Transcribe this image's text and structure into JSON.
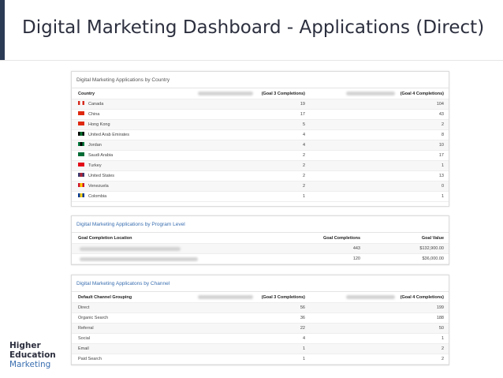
{
  "slide": {
    "title": "Digital Marketing Dashboard - Applications (Direct)",
    "logo": {
      "line1": "Higher",
      "line2": "Education",
      "line3": "Marketing"
    }
  },
  "country_panel": {
    "title": "Digital Marketing Applications by Country",
    "headers": {
      "name": "Country",
      "v1": "(Goal 3 Completions)",
      "v2": "(Goal 4 Completions)"
    },
    "rows": [
      {
        "name": "Canada",
        "v1": "19",
        "v2": "104",
        "flag": [
          "#ffffff",
          "#d52b1e"
        ]
      },
      {
        "name": "China",
        "v1": "17",
        "v2": "43",
        "flag": [
          "#de2910",
          "#de2910"
        ]
      },
      {
        "name": "Hong Kong",
        "v1": "5",
        "v2": "2",
        "flag": [
          "#de2910",
          "#de2910"
        ]
      },
      {
        "name": "United Arab Emirates",
        "v1": "4",
        "v2": "8",
        "flag": [
          "#00732f",
          "#000000"
        ]
      },
      {
        "name": "Jordan",
        "v1": "4",
        "v2": "10",
        "flag": [
          "#000000",
          "#007a3d"
        ]
      },
      {
        "name": "Saudi Arabia",
        "v1": "2",
        "v2": "17",
        "flag": [
          "#006c35",
          "#006c35"
        ]
      },
      {
        "name": "Turkey",
        "v1": "2",
        "v2": "1",
        "flag": [
          "#e30a17",
          "#e30a17"
        ]
      },
      {
        "name": "United States",
        "v1": "2",
        "v2": "13",
        "flag": [
          "#b22234",
          "#3c3b6e"
        ]
      },
      {
        "name": "Venezuela",
        "v1": "2",
        "v2": "0",
        "flag": [
          "#ffcc00",
          "#cf142b"
        ]
      },
      {
        "name": "Colombia",
        "v1": "1",
        "v2": "1",
        "flag": [
          "#fcd116",
          "#003893"
        ]
      }
    ]
  },
  "program_panel": {
    "title": "Digital Marketing Applications by Program Level",
    "headers": {
      "name": "Goal Completion Location",
      "v1": "Goal Completions",
      "v2": "Goal Value"
    },
    "rows": [
      {
        "v1": "443",
        "v2": "$132,900.00"
      },
      {
        "v1": "120",
        "v2": "$36,000.00"
      }
    ]
  },
  "channel_panel": {
    "title": "Digital Marketing Applicatons by Channel",
    "headers": {
      "name": "Default Channel Grouping",
      "v1": "(Goal 3 Completions)",
      "v2": "(Goal 4 Completions)"
    },
    "rows": [
      {
        "name": "Direct",
        "v1": "56",
        "v2": "199"
      },
      {
        "name": "Organic Search",
        "v1": "36",
        "v2": "188"
      },
      {
        "name": "Referral",
        "v1": "22",
        "v2": "50"
      },
      {
        "name": "Social",
        "v1": "4",
        "v2": "1"
      },
      {
        "name": "Email",
        "v1": "1",
        "v2": "2"
      },
      {
        "name": "Paid Search",
        "v1": "1",
        "v2": "2"
      }
    ]
  }
}
